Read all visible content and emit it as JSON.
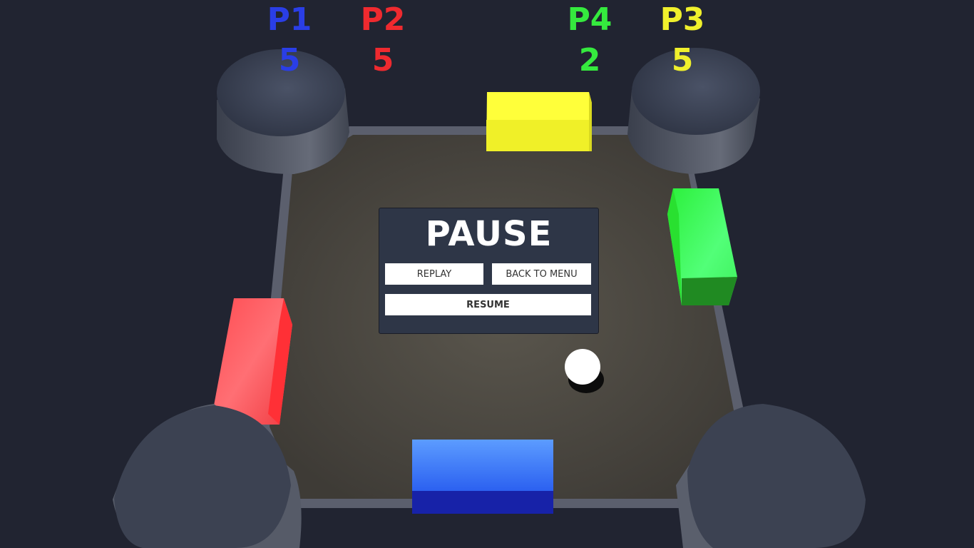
{
  "scoreboard": [
    {
      "player": "P1",
      "score": "5",
      "color": "#2a3ee6"
    },
    {
      "player": "P2",
      "score": "5",
      "color": "#ef2a2f"
    },
    {
      "player": "P4",
      "score": "2",
      "color": "#35ea3e"
    },
    {
      "player": "P3",
      "score": "5",
      "color": "#f0f02c"
    }
  ],
  "pause_menu": {
    "title": "PAUSE",
    "replay_label": "REPLAY",
    "back_label": "BACK TO MENU",
    "resume_label": "RESUME"
  },
  "colors": {
    "background": "#212431",
    "arena_floor": "#4f4b44",
    "arena_wall": "#5b5f6d",
    "pillar": "#3a4050",
    "paddle_p1": "#4a8cff",
    "paddle_p2": "#ff4a50",
    "paddle_p3": "#ffff3a",
    "paddle_p4": "#3eff5c",
    "ball": "#ffffff"
  }
}
